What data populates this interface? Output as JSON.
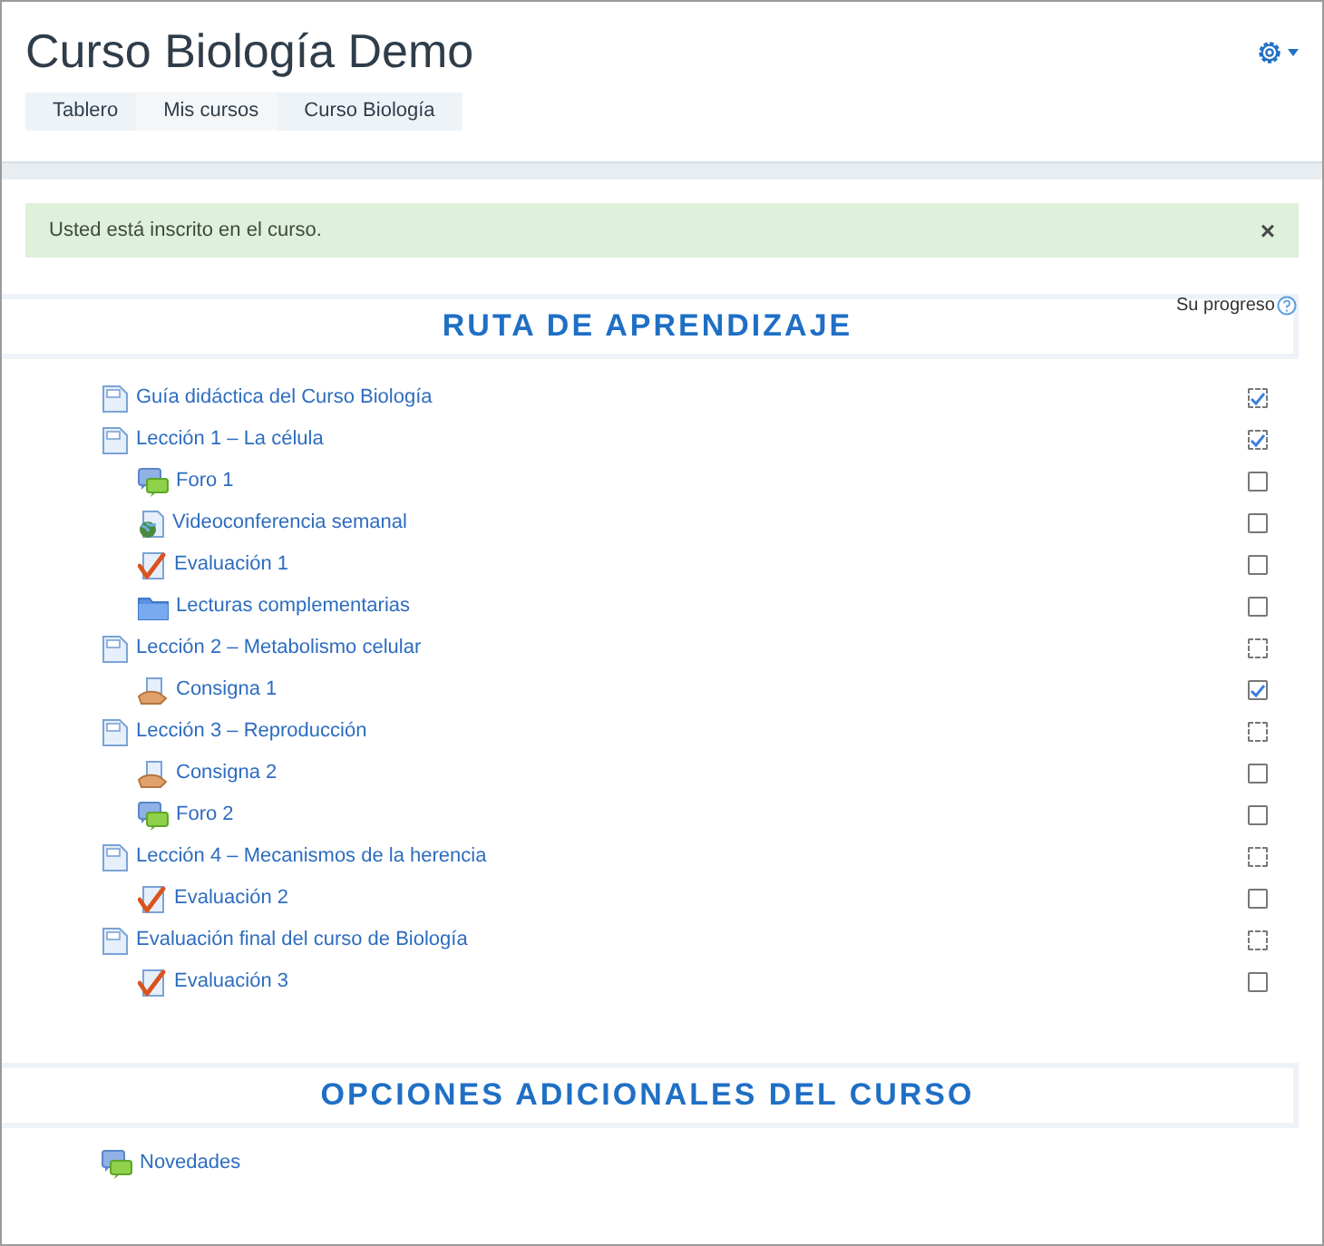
{
  "page_title": "Curso Biología Demo",
  "breadcrumb": [
    "Tablero",
    "Mis cursos",
    "Curso Biología"
  ],
  "alert": {
    "message": "Usted está inscrito en el curso.",
    "close": "×"
  },
  "progress_label": "Su progreso",
  "sections": [
    {
      "title": "RUTA DE APRENDIZAJE",
      "items": [
        {
          "kind": "page",
          "label": "Guía didáctica del Curso Biología",
          "completion": {
            "kind": "auto",
            "checked": true
          }
        },
        {
          "kind": "page",
          "label": "Lección 1 – La célula",
          "completion": {
            "kind": "auto",
            "checked": true
          },
          "children": [
            {
              "kind": "forum",
              "label": "Foro 1",
              "completion": {
                "kind": "manual",
                "checked": false
              }
            },
            {
              "kind": "url",
              "label": "Videoconferencia semanal",
              "completion": {
                "kind": "manual",
                "checked": false
              }
            },
            {
              "kind": "quiz",
              "label": "Evaluación 1",
              "completion": {
                "kind": "manual",
                "checked": false
              }
            },
            {
              "kind": "folder",
              "label": "Lecturas complementarias",
              "completion": {
                "kind": "manual",
                "checked": false
              }
            }
          ]
        },
        {
          "kind": "page",
          "label": "Lección 2 – Metabolismo celular",
          "completion": {
            "kind": "auto",
            "checked": false
          },
          "children": [
            {
              "kind": "assign",
              "label": "Consigna 1",
              "completion": {
                "kind": "manual",
                "checked": true
              }
            }
          ]
        },
        {
          "kind": "page",
          "label": "Lección 3 – Reproducción",
          "completion": {
            "kind": "auto",
            "checked": false
          },
          "children": [
            {
              "kind": "assign",
              "label": "Consigna 2",
              "completion": {
                "kind": "manual",
                "checked": false
              }
            },
            {
              "kind": "forum",
              "label": "Foro 2",
              "completion": {
                "kind": "manual",
                "checked": false
              }
            }
          ]
        },
        {
          "kind": "page",
          "label": "Lección 4 – Mecanismos de la herencia",
          "completion": {
            "kind": "auto",
            "checked": false
          },
          "children": [
            {
              "kind": "quiz",
              "label": "Evaluación 2",
              "completion": {
                "kind": "manual",
                "checked": false
              }
            }
          ]
        },
        {
          "kind": "page",
          "label": "Evaluación final del curso de Biología",
          "completion": {
            "kind": "auto",
            "checked": false
          },
          "children": [
            {
              "kind": "quiz",
              "label": "Evaluación 3",
              "completion": {
                "kind": "manual",
                "checked": false
              }
            }
          ]
        }
      ]
    },
    {
      "title": "OPCIONES ADICIONALES DEL CURSO",
      "items": [
        {
          "kind": "forum",
          "label": "Novedades"
        }
      ]
    }
  ]
}
